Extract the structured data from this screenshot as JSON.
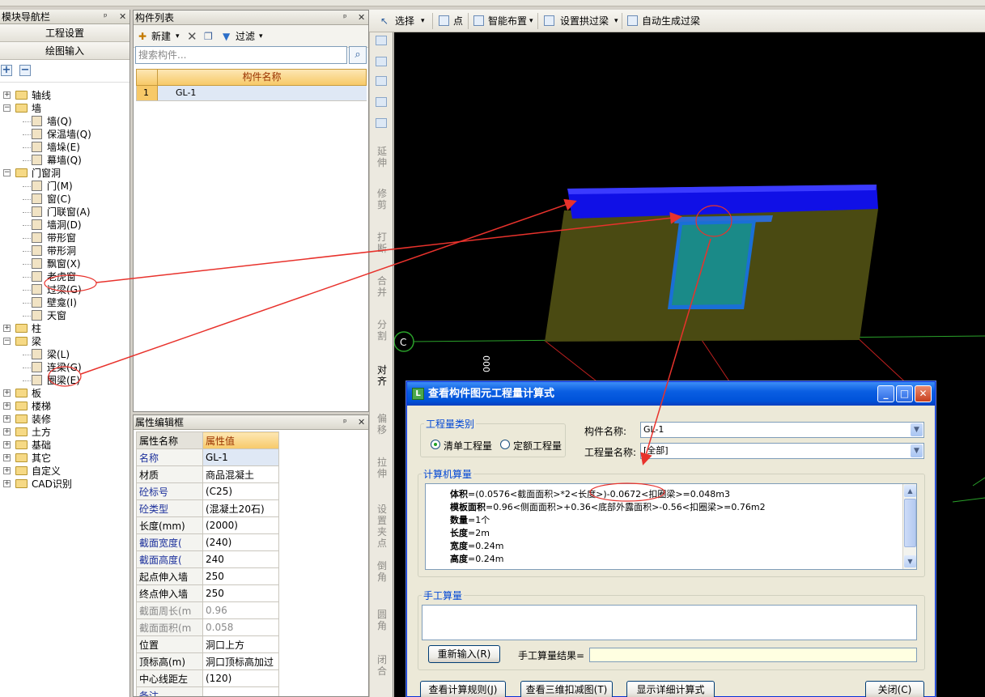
{
  "nav": {
    "title": "模块导航栏",
    "btn_project": "工程设置",
    "btn_draw": "绘图输入",
    "tree": [
      {
        "label": "轴线",
        "level": 0,
        "expanded": false
      },
      {
        "label": "墙",
        "level": 0,
        "expanded": true
      },
      {
        "label": "墙(Q)",
        "level": 1
      },
      {
        "label": "保温墙(Q)",
        "level": 1
      },
      {
        "label": "墙垛(E)",
        "level": 1
      },
      {
        "label": "幕墙(Q)",
        "level": 1
      },
      {
        "label": "门窗洞",
        "level": 0,
        "expanded": true
      },
      {
        "label": "门(M)",
        "level": 1
      },
      {
        "label": "窗(C)",
        "level": 1
      },
      {
        "label": "门联窗(A)",
        "level": 1
      },
      {
        "label": "墙洞(D)",
        "level": 1
      },
      {
        "label": "带形窗",
        "level": 1
      },
      {
        "label": "带形洞",
        "level": 1
      },
      {
        "label": "飘窗(X)",
        "level": 1
      },
      {
        "label": "老虎窗",
        "level": 1
      },
      {
        "label": "过梁(G)",
        "level": 1
      },
      {
        "label": "壁龛(I)",
        "level": 1
      },
      {
        "label": "天窗",
        "level": 1
      },
      {
        "label": "柱",
        "level": 0,
        "expanded": false
      },
      {
        "label": "梁",
        "level": 0,
        "expanded": true
      },
      {
        "label": "梁(L)",
        "level": 1
      },
      {
        "label": "连梁(G)",
        "level": 1
      },
      {
        "label": "圈梁(E)",
        "level": 1
      },
      {
        "label": "板",
        "level": 0,
        "expanded": false
      },
      {
        "label": "楼梯",
        "level": 0,
        "expanded": false
      },
      {
        "label": "装修",
        "level": 0,
        "expanded": false
      },
      {
        "label": "土方",
        "level": 0,
        "expanded": false
      },
      {
        "label": "基础",
        "level": 0,
        "expanded": false
      },
      {
        "label": "其它",
        "level": 0,
        "expanded": false
      },
      {
        "label": "自定义",
        "level": 0,
        "expanded": false
      },
      {
        "label": "CAD识别",
        "level": 0,
        "expanded": false
      }
    ]
  },
  "complist": {
    "title": "构件列表",
    "new_label": "新建",
    "filter_label": "过滤",
    "search_placeholder": "搜索构件...",
    "col_name": "构件名称",
    "rows": [
      {
        "num": "1",
        "name": "GL-1"
      }
    ]
  },
  "props": {
    "title": "属性编辑框",
    "col_name": "属性名称",
    "col_value": "属性值",
    "rows": [
      {
        "k": "名称",
        "v": "GL-1",
        "style": "blue",
        "sel": true
      },
      {
        "k": "材质",
        "v": "商品混凝土",
        "style": ""
      },
      {
        "k": "砼标号",
        "v": "(C25)",
        "style": "blue"
      },
      {
        "k": "砼类型",
        "v": "(混凝土20石)",
        "style": "blue"
      },
      {
        "k": "长度(mm)",
        "v": "(2000)",
        "style": ""
      },
      {
        "k": "截面宽度(",
        "v": "(240)",
        "style": "blue"
      },
      {
        "k": "截面高度(",
        "v": "240",
        "style": "blue"
      },
      {
        "k": "起点伸入墙",
        "v": "250",
        "style": ""
      },
      {
        "k": "终点伸入墙",
        "v": "250",
        "style": ""
      },
      {
        "k": "截面周长(m",
        "v": "0.96",
        "style": "gray"
      },
      {
        "k": "截面面积(m",
        "v": "0.058",
        "style": "gray"
      },
      {
        "k": "位置",
        "v": "洞口上方",
        "style": ""
      },
      {
        "k": "顶标高(m)",
        "v": "洞口顶标高加过",
        "style": ""
      },
      {
        "k": "中心线距左",
        "v": "(120)",
        "style": ""
      },
      {
        "k": "备注",
        "v": "",
        "style": "blue"
      }
    ]
  },
  "viewbar": {
    "select": "选择",
    "point": "点",
    "smart": "智能布置",
    "arch": "设置拱过梁",
    "auto": "自动生成过梁"
  },
  "vtools": [
    "延伸",
    "修剪",
    "打断",
    "合并",
    "分割",
    "对齐",
    "偏移",
    "拉伸",
    "设置夹点",
    "倒角",
    "圆角",
    "闭合"
  ],
  "viewport": {
    "axis_label": "C",
    "axis_dim": "000"
  },
  "dialog": {
    "title": "查看构件图元工程量计算式",
    "qty_group": "工程量类别",
    "radio_bill": "清单工程量",
    "radio_quota": "定额工程量",
    "comp_name_label": "构件名称:",
    "comp_name_value": "GL-1",
    "qty_name_label": "工程量名称:",
    "qty_name_value": "[全部]",
    "calc_group": "计算机算量",
    "calc_lines": [
      {
        "b": "体积",
        "t": "=(0.0576<截面面积>*2<长度>)-0.0672<扣圈梁>=0.048m3"
      },
      {
        "b": "模板面积",
        "t": "=0.96<侧面面积>+0.36<底部外露面积>-0.56<扣圈梁>=0.76m2"
      },
      {
        "b": "数量",
        "t": "=1个"
      },
      {
        "b": "长度",
        "t": "=2m"
      },
      {
        "b": "宽度",
        "t": "=0.24m"
      },
      {
        "b": "高度",
        "t": "=0.24m"
      }
    ],
    "manual_group": "手工算量",
    "reinput_btn": "重新输入(R)",
    "manual_result_label": "手工算量结果=",
    "btn_rules": "查看计算规则(J)",
    "btn_3d": "查看三维扣减图(T)",
    "btn_detail": "显示详细计算式",
    "btn_close": "关闭(C)"
  }
}
